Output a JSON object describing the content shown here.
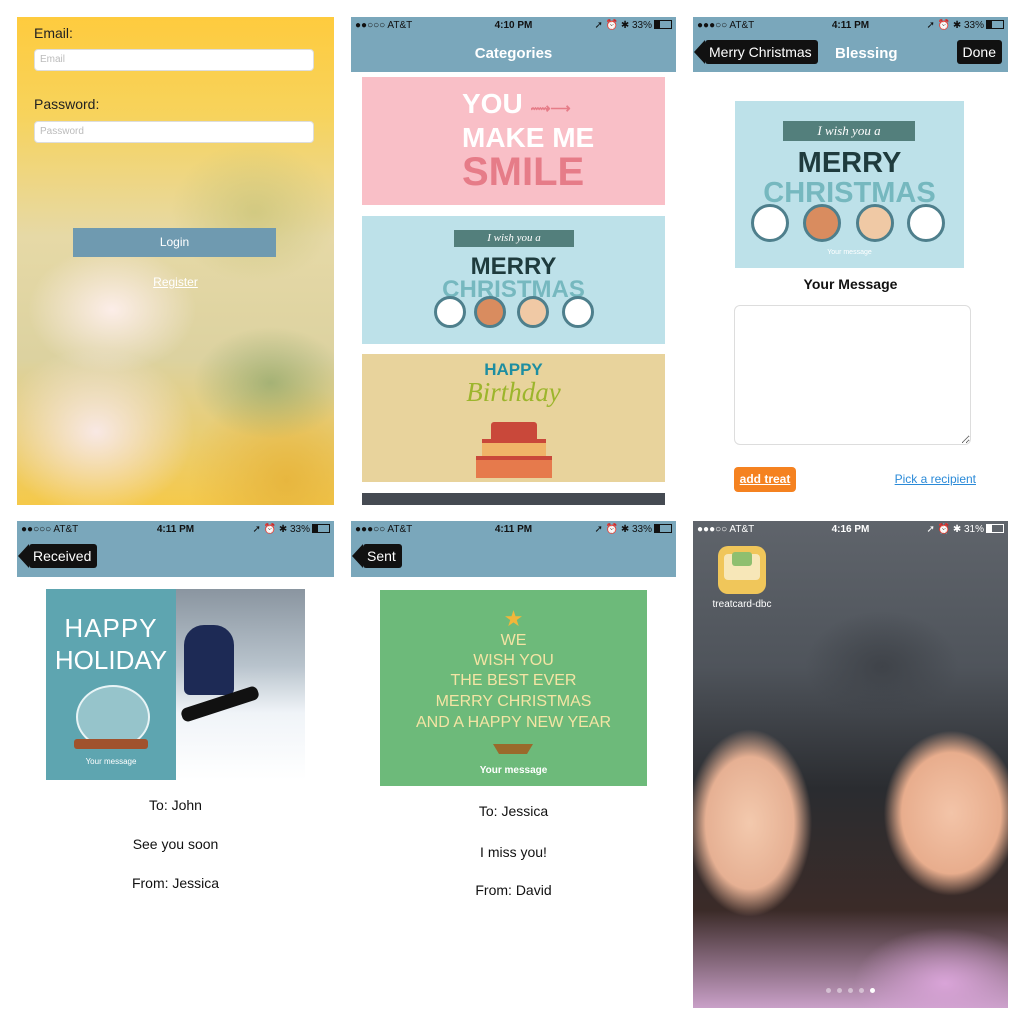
{
  "login": {
    "email_label": "Email:",
    "email_placeholder": "Email",
    "password_label": "Password:",
    "password_placeholder": "Password",
    "login_button": "Login",
    "register_link": "Register"
  },
  "categories": {
    "status": {
      "carrier": "●●○○○ AT&T ",
      "time": "4:10 PM",
      "battery": "33%"
    },
    "title": "Categories",
    "cards": [
      {
        "line1": "YOU",
        "line2": "MAKE ME",
        "line3": "SMILE"
      },
      {
        "ribbon": "I wish you a",
        "merry": "MERRY",
        "christmas": "CHRISTMAS"
      },
      {
        "happy": "HAPPY",
        "birthday": "Birthday"
      }
    ]
  },
  "compose": {
    "status": {
      "carrier": "●●●○○ AT&T ",
      "time": "4:11 PM",
      "battery": "33%"
    },
    "back_label": "Merry Christmas",
    "title": "Blessing",
    "done_label": "Done",
    "card": {
      "ribbon": "I wish you a",
      "merry": "MERRY",
      "christmas": "CHRISTMAS",
      "caption": "Your message"
    },
    "message_heading": "Your Message",
    "message_value": "",
    "add_treat": "add treat",
    "pick_recipient": "Pick a recipient"
  },
  "received": {
    "status": {
      "carrier": "●●○○○ AT&T ",
      "time": "4:11 PM",
      "battery": "33%"
    },
    "back_label": "Received",
    "card": {
      "line1": "HAPPY",
      "line2": "HOLIDAY",
      "caption": "Your message"
    },
    "to": "To: John",
    "message": "See you soon",
    "from": "From: Jessica"
  },
  "sent": {
    "status": {
      "carrier": "●●●○○ AT&T ",
      "time": "4:11 PM",
      "battery": "33%"
    },
    "back_label": "Sent",
    "card": {
      "lines": [
        "WE",
        "WISH YOU",
        "THE BEST EVER",
        "MERRY CHRISTMAS",
        "AND A HAPPY NEW YEAR"
      ],
      "caption": "Your message"
    },
    "to": "To: Jessica",
    "message": "I miss you!",
    "from": "From: David"
  },
  "home": {
    "status": {
      "carrier": "●●●○○ AT&T ",
      "time": "4:16 PM",
      "battery": "31%"
    },
    "app_name": "treatcard-dbc",
    "page_count": 5,
    "active_page": 5
  },
  "colors": {
    "nav": "#7aa7bb",
    "accent": "#f58220",
    "link": "#2a8ad8",
    "login_button": "#6f9ab0"
  }
}
